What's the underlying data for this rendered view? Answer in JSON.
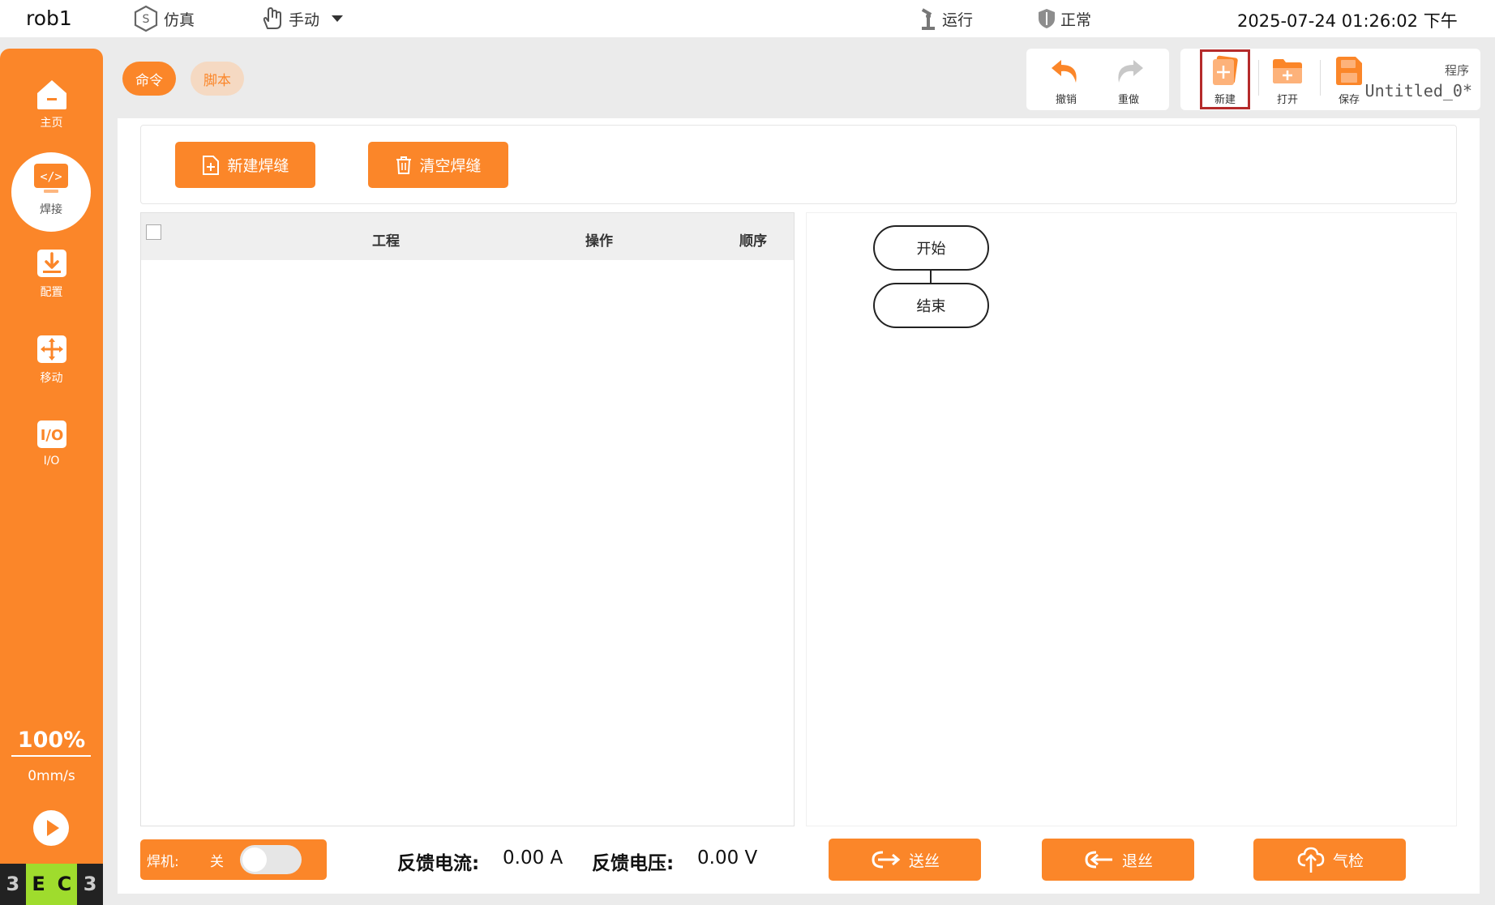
{
  "header": {
    "robot_name": "rob1",
    "sim_label": "仿真",
    "manual_label": "手动",
    "run_label": "运行",
    "status_label": "正常",
    "datetime": "2025-07-24 01:26:02 下午"
  },
  "sidebar": {
    "items": [
      {
        "label": "主页",
        "icon": "home-icon"
      },
      {
        "label": "焊接",
        "icon": "code-icon"
      },
      {
        "label": "配置",
        "icon": "download-icon"
      },
      {
        "label": "移动",
        "icon": "move-icon"
      },
      {
        "label": "I/O",
        "icon": "io-icon"
      }
    ],
    "speed_percent": "100%",
    "speed_value": "0mm/s",
    "logo_letters": [
      "3",
      "E",
      "C",
      "3"
    ]
  },
  "mode_tabs": {
    "command": "命令",
    "script": "脚本"
  },
  "toolbar": {
    "undo": "撤销",
    "redo": "重做",
    "new": "新建",
    "open": "打开",
    "save": "保存",
    "program_label": "程序",
    "program_name": "Untitled_0*"
  },
  "seam_actions": {
    "new_seam": "新建焊缝",
    "clear_seam": "清空焊缝"
  },
  "table": {
    "columns": [
      "工程",
      "操作",
      "顺序"
    ],
    "rows": []
  },
  "flowchart": {
    "start": "开始",
    "end": "结束"
  },
  "footer": {
    "welder_label": "焊机:",
    "welder_state": "关",
    "current_label": "反馈电流:",
    "current_value": "0.00 A",
    "voltage_label": "反馈电压:",
    "voltage_value": "0.00 V",
    "feed_wire": "送丝",
    "retract_wire": "退丝",
    "gas_check": "气检"
  },
  "colors": {
    "accent": "#fb8629",
    "highlight_border": "#b52b2b"
  }
}
